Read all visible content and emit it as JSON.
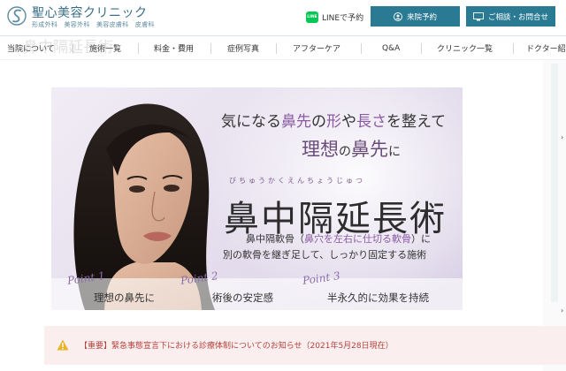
{
  "header": {
    "logo_name": "聖心美容クリニック",
    "logo_sub": "形成外科　美容外科　美容皮膚科　皮膚科",
    "line_icon_text": "LINE",
    "line_label": "LINEで予約",
    "visit_label": "来院予約",
    "consult_label": "ご相談・お問合せ"
  },
  "nav": {
    "items": [
      "当院について",
      "施術一覧",
      "料金・費用",
      "症例写真",
      "アフターケア",
      "Q&A",
      "クリニック一覧",
      "ドクター紹"
    ],
    "ghost_title": "鼻中隔延長術"
  },
  "banner": {
    "line1_a": "気になる",
    "line1_b": "鼻先",
    "line1_c": "の",
    "line1_d": "形",
    "line1_e": "や",
    "line1_f": "長さ",
    "line1_g": "を整えて",
    "line2_a": "理想",
    "line2_b": "の",
    "line2_c": "鼻先",
    "line2_d": "に",
    "ruby": "びちゅうかくえんちょうじゅつ",
    "title": "鼻中隔延長術",
    "desc1_a": "鼻中隔軟骨（",
    "desc1_b": "鼻穴を左右に仕切る軟骨",
    "desc1_c": "）に",
    "desc2": "別の軟骨を継ぎ足して、しっかり固定する施術",
    "points": [
      {
        "label": "Point 1",
        "text": "理想の鼻先に"
      },
      {
        "label": "Point 2",
        "text": "術後の安定感"
      },
      {
        "label": "Point 3",
        "text": "半永久的に効果を持続"
      }
    ]
  },
  "notice": {
    "text": "【重要】緊急事態宣言下における診療体制についてのお知らせ（2021年5月28日現在）"
  },
  "colors": {
    "brand": "#2a7a94",
    "accent": "#8a5aa2",
    "notice_bg": "#fbeeee",
    "notice_text": "#b3423f",
    "line_green": "#06c755"
  }
}
